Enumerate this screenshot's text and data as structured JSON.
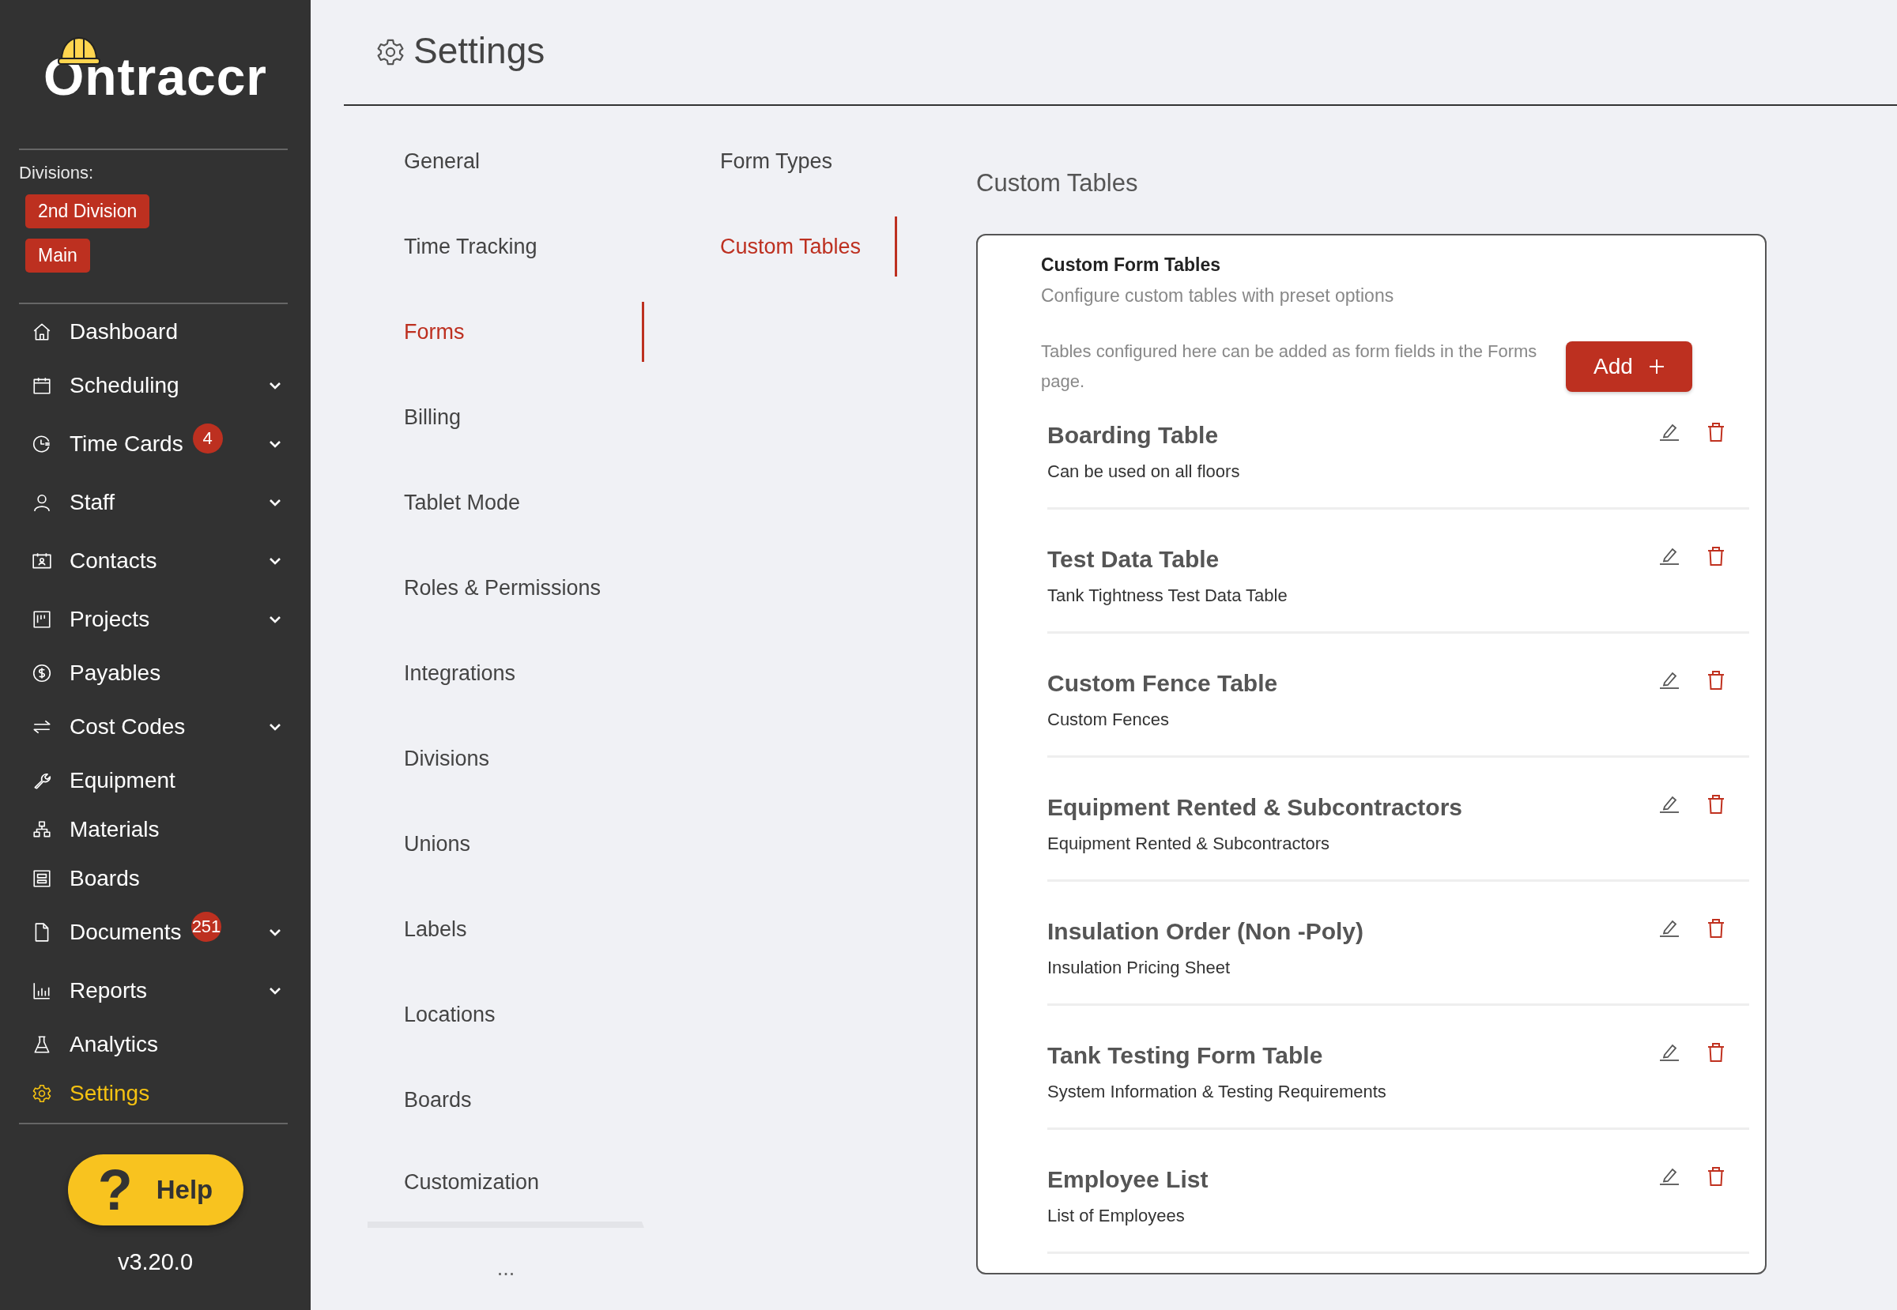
{
  "sidebar": {
    "logo": "Ontraccr",
    "divisions_label": "Divisions:",
    "divisions": [
      "2nd Division",
      "Main"
    ],
    "items": [
      {
        "label": "Dashboard",
        "kind": "home",
        "expandable": false,
        "selected": false
      },
      {
        "label": "Scheduling",
        "kind": "calendar",
        "expandable": true,
        "selected": false
      },
      {
        "label": "Time Cards",
        "kind": "clock",
        "expandable": true,
        "badge": "4",
        "selected": false
      },
      {
        "label": "Staff",
        "kind": "person",
        "expandable": true,
        "selected": false
      },
      {
        "label": "Contacts",
        "kind": "contact",
        "expandable": true,
        "selected": false
      },
      {
        "label": "Projects",
        "kind": "project",
        "expandable": true,
        "selected": false
      },
      {
        "label": "Payables",
        "kind": "dollar",
        "expandable": false,
        "selected": false
      },
      {
        "label": "Cost Codes",
        "kind": "swap",
        "expandable": true,
        "selected": false
      },
      {
        "label": "Equipment",
        "kind": "wrench",
        "expandable": false,
        "selected": false
      },
      {
        "label": "Materials",
        "kind": "tree",
        "expandable": false,
        "selected": false
      },
      {
        "label": "Boards",
        "kind": "board",
        "expandable": false,
        "selected": false
      },
      {
        "label": "Documents",
        "kind": "file",
        "expandable": true,
        "badge": "251",
        "selected": false
      },
      {
        "label": "Reports",
        "kind": "chart",
        "expandable": true,
        "selected": false
      },
      {
        "label": "Analytics",
        "kind": "flask",
        "expandable": false,
        "selected": false
      },
      {
        "label": "Settings",
        "kind": "gear",
        "expandable": false,
        "selected": true
      }
    ],
    "help_button": {
      "icon": "?",
      "label": "Help"
    },
    "version": "v3.20.0"
  },
  "header": {
    "title": "Settings"
  },
  "settings_menu": {
    "items": [
      {
        "label": "General",
        "selected": false
      },
      {
        "label": "Time Tracking",
        "selected": false
      },
      {
        "label": "Forms",
        "selected": true
      },
      {
        "label": "Billing",
        "selected": false
      },
      {
        "label": "Tablet Mode",
        "selected": false
      },
      {
        "label": "Roles & Permissions",
        "selected": false
      },
      {
        "label": "Integrations",
        "selected": false
      },
      {
        "label": "Divisions",
        "selected": false
      },
      {
        "label": "Unions",
        "selected": false
      },
      {
        "label": "Labels",
        "selected": false
      },
      {
        "label": "Locations",
        "selected": false
      },
      {
        "label": "Boards",
        "selected": false
      },
      {
        "label": "Customization",
        "selected": false
      }
    ],
    "more": "..."
  },
  "forms_menu": {
    "items": [
      {
        "label": "Form Types",
        "selected": false
      },
      {
        "label": "Custom Tables",
        "selected": true
      }
    ]
  },
  "content": {
    "title": "Custom Tables",
    "card": {
      "title": "Custom Form Tables",
      "subtitle": "Configure custom tables with preset options",
      "description": "Tables configured here can be added as form fields in the Forms page.",
      "add_button": "Add",
      "tables": [
        {
          "name": "Boarding Table",
          "description": "Can be used on all floors"
        },
        {
          "name": "Test Data Table",
          "description": "Tank Tightness Test Data Table"
        },
        {
          "name": "Custom Fence Table",
          "description": "Custom Fences"
        },
        {
          "name": "Equipment Rented & Subcontractors",
          "description": "Equipment Rented & Subcontractors"
        },
        {
          "name": "Insulation Order (Non -Poly)",
          "description": "Insulation Pricing Sheet"
        },
        {
          "name": "Tank Testing Form Table",
          "description": "System Information & Testing Requirements"
        },
        {
          "name": "Employee List",
          "description": "List of Employees"
        }
      ]
    }
  }
}
